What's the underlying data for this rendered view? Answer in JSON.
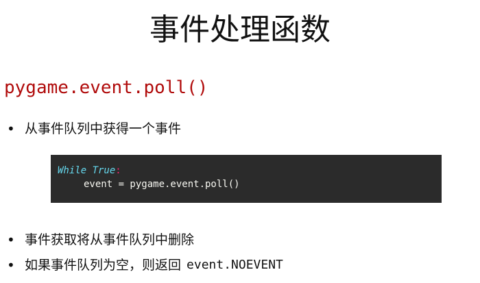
{
  "slide": {
    "title": "事件处理函数",
    "code_heading": "pygame.event.poll()"
  },
  "bullets": [
    {
      "text": "从事件队列中获得一个事件"
    },
    {
      "text": "事件获取将从事件队列中删除"
    },
    {
      "text": "如果事件队列为空，则返回",
      "code": "event.NOEVENT"
    }
  ],
  "code_block": {
    "line1_keyword": "While True",
    "line1_colon": ":",
    "line2": "event = pygame.event.poll()"
  },
  "colors": {
    "heading_code": "#b00a0a",
    "code_background": "#2b2b2b",
    "keyword": "#66d9ef",
    "colon": "#f92672"
  }
}
